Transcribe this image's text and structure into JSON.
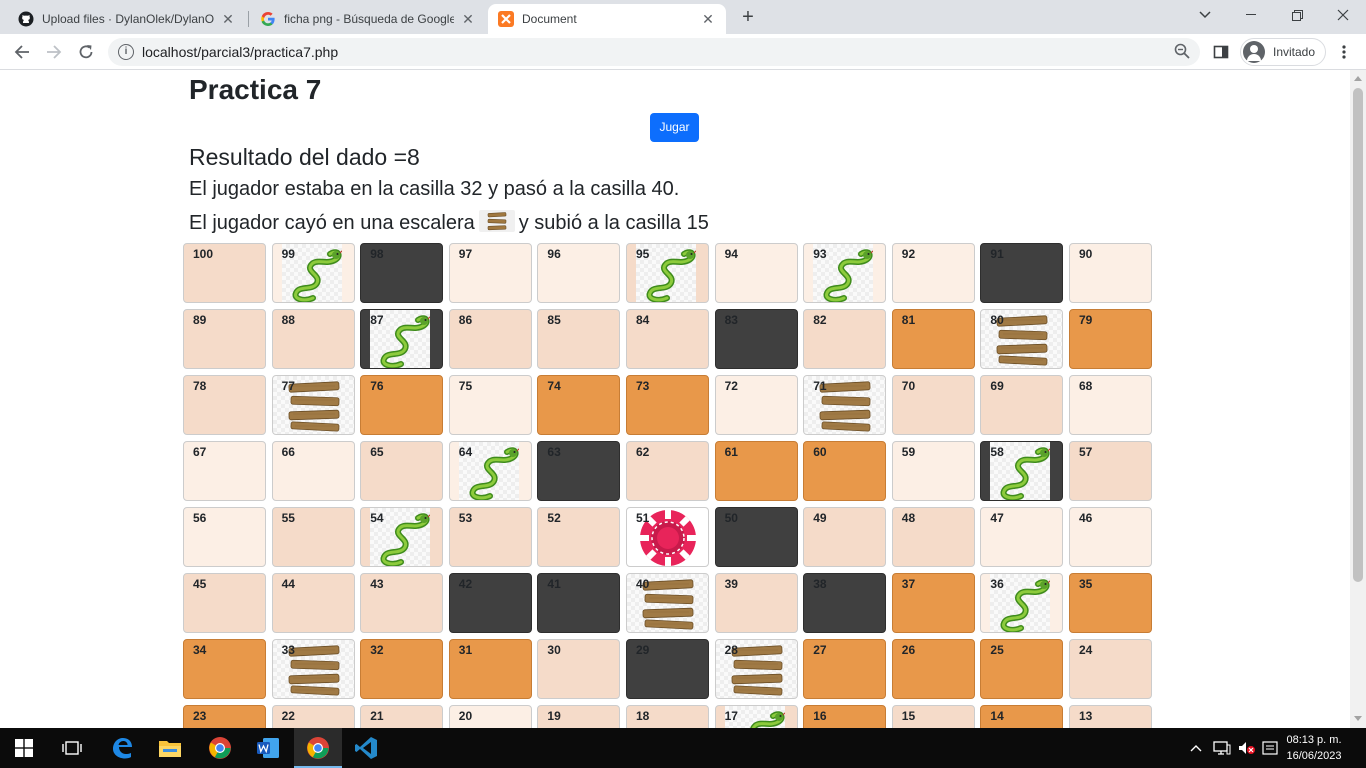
{
  "browser": {
    "tabs": [
      {
        "title": "Upload files · DylanOlek/DylanOl",
        "icon": "github-icon",
        "active": false
      },
      {
        "title": "ficha png - Búsqueda de Google",
        "icon": "google-icon",
        "active": false
      },
      {
        "title": "Document",
        "icon": "xampp-icon",
        "active": true
      }
    ],
    "url": "localhost/parcial3/practica7.php",
    "profile_label": "Invitado"
  },
  "page": {
    "title": "Practica 7",
    "play_button": "Jugar",
    "dice_result": "Resultado del dado =8",
    "move_text": "El jugador estaba en la casilla 32 y pasó a la casilla 40.",
    "ladder_text_before": "El jugador cayó en una escalera",
    "ladder_text_after": "y subió a la casilla 15"
  },
  "board": {
    "rows": [
      [
        {
          "n": "100",
          "t": "mid"
        },
        {
          "n": "99",
          "t": "light",
          "icon": "snake"
        },
        {
          "n": "98",
          "t": "dark"
        },
        {
          "n": "97",
          "t": "light"
        },
        {
          "n": "96",
          "t": "light"
        },
        {
          "n": "95",
          "t": "mid",
          "icon": "snake"
        },
        {
          "n": "94",
          "t": "light"
        },
        {
          "n": "93",
          "t": "light",
          "icon": "snake"
        },
        {
          "n": "92",
          "t": "light"
        },
        {
          "n": "91",
          "t": "dark"
        },
        {
          "n": "90",
          "t": "light"
        }
      ],
      [
        {
          "n": "89",
          "t": "mid"
        },
        {
          "n": "88",
          "t": "mid"
        },
        {
          "n": "87",
          "t": "dark",
          "icon": "snake"
        },
        {
          "n": "86",
          "t": "mid"
        },
        {
          "n": "85",
          "t": "mid"
        },
        {
          "n": "84",
          "t": "mid"
        },
        {
          "n": "83",
          "t": "dark"
        },
        {
          "n": "82",
          "t": "mid"
        },
        {
          "n": "81",
          "t": "orange"
        },
        {
          "n": "80",
          "t": "check",
          "icon": "ladder"
        },
        {
          "n": "79",
          "t": "orange"
        }
      ],
      [
        {
          "n": "78",
          "t": "mid"
        },
        {
          "n": "77",
          "t": "check",
          "icon": "ladder"
        },
        {
          "n": "76",
          "t": "orange"
        },
        {
          "n": "75",
          "t": "light"
        },
        {
          "n": "74",
          "t": "orange"
        },
        {
          "n": "73",
          "t": "orange"
        },
        {
          "n": "72",
          "t": "light"
        },
        {
          "n": "71",
          "t": "check",
          "icon": "ladder"
        },
        {
          "n": "70",
          "t": "mid"
        },
        {
          "n": "69",
          "t": "mid"
        },
        {
          "n": "68",
          "t": "light"
        }
      ],
      [
        {
          "n": "67",
          "t": "light"
        },
        {
          "n": "66",
          "t": "light"
        },
        {
          "n": "65",
          "t": "mid"
        },
        {
          "n": "64",
          "t": "light",
          "icon": "snake"
        },
        {
          "n": "63",
          "t": "dark"
        },
        {
          "n": "62",
          "t": "mid"
        },
        {
          "n": "61",
          "t": "orange"
        },
        {
          "n": "60",
          "t": "orange"
        },
        {
          "n": "59",
          "t": "light"
        },
        {
          "n": "58",
          "t": "dark",
          "icon": "snake"
        },
        {
          "n": "57",
          "t": "mid"
        }
      ],
      [
        {
          "n": "56",
          "t": "light"
        },
        {
          "n": "55",
          "t": "mid"
        },
        {
          "n": "54",
          "t": "mid",
          "icon": "snake"
        },
        {
          "n": "53",
          "t": "mid"
        },
        {
          "n": "52",
          "t": "mid"
        },
        {
          "n": "51",
          "t": "white",
          "icon": "chip"
        },
        {
          "n": "50",
          "t": "dark"
        },
        {
          "n": "49",
          "t": "mid"
        },
        {
          "n": "48",
          "t": "mid"
        },
        {
          "n": "47",
          "t": "light"
        },
        {
          "n": "46",
          "t": "light"
        }
      ],
      [
        {
          "n": "45",
          "t": "mid"
        },
        {
          "n": "44",
          "t": "mid"
        },
        {
          "n": "43",
          "t": "mid"
        },
        {
          "n": "42",
          "t": "dark"
        },
        {
          "n": "41",
          "t": "dark"
        },
        {
          "n": "40",
          "t": "check",
          "icon": "ladder"
        },
        {
          "n": "39",
          "t": "mid"
        },
        {
          "n": "38",
          "t": "dark"
        },
        {
          "n": "37",
          "t": "orange"
        },
        {
          "n": "36",
          "t": "light",
          "icon": "snake"
        },
        {
          "n": "35",
          "t": "orange"
        }
      ],
      [
        {
          "n": "34",
          "t": "orange"
        },
        {
          "n": "33",
          "t": "check",
          "icon": "ladder"
        },
        {
          "n": "32",
          "t": "orange"
        },
        {
          "n": "31",
          "t": "orange"
        },
        {
          "n": "30",
          "t": "mid"
        },
        {
          "n": "29",
          "t": "dark"
        },
        {
          "n": "28",
          "t": "check",
          "icon": "ladder"
        },
        {
          "n": "27",
          "t": "orange"
        },
        {
          "n": "26",
          "t": "orange"
        },
        {
          "n": "25",
          "t": "orange"
        },
        {
          "n": "24",
          "t": "mid"
        }
      ],
      [
        {
          "n": "23",
          "t": "orange"
        },
        {
          "n": "22",
          "t": "mid"
        },
        {
          "n": "21",
          "t": "mid"
        },
        {
          "n": "20",
          "t": "light"
        },
        {
          "n": "19",
          "t": "mid"
        },
        {
          "n": "18",
          "t": "mid"
        },
        {
          "n": "17",
          "t": "mid",
          "icon": "snake"
        },
        {
          "n": "16",
          "t": "orange"
        },
        {
          "n": "15",
          "t": "mid"
        },
        {
          "n": "14",
          "t": "orange"
        },
        {
          "n": "13",
          "t": "mid"
        }
      ]
    ]
  },
  "taskbar": {
    "items": [
      "windows-start-icon",
      "task-view-icon",
      "edge-icon",
      "file-explorer-icon",
      "chrome-icon",
      "word-icon",
      "chrome-icon",
      "vscode-icon"
    ],
    "time": "08:13 p. m.",
    "date": "16/06/2023"
  }
}
